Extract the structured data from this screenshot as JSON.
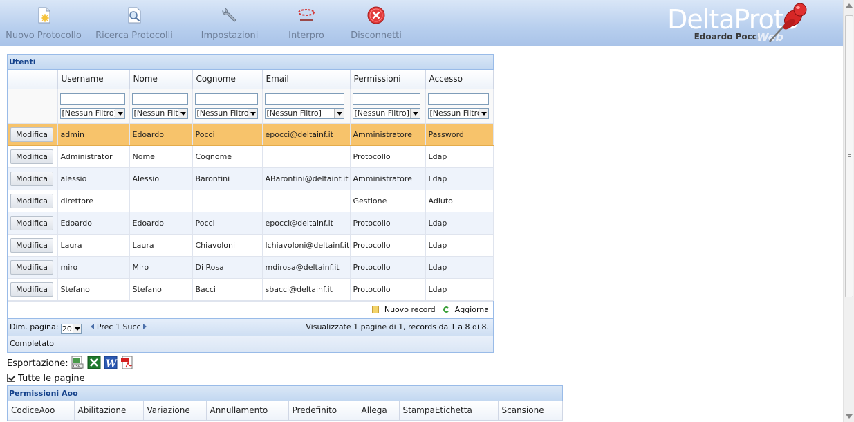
{
  "toolbar": {
    "items": [
      {
        "label": "Nuovo Protocollo",
        "icon": "new-document-icon"
      },
      {
        "label": "Ricerca Protocolli",
        "icon": "search-document-icon"
      },
      {
        "label": "Impostazioni",
        "icon": "wrench-icon"
      },
      {
        "label": "Interpro",
        "icon": "interpro-logo-icon"
      },
      {
        "label": "Disconnetti",
        "icon": "disconnect-icon"
      }
    ]
  },
  "brand": {
    "name": "DeltaProto",
    "suffix": "Web",
    "user": "Edoardo Pocci"
  },
  "users_panel": {
    "title": "Utenti",
    "columns": [
      "Username",
      "Nome",
      "Cognome",
      "Email",
      "Permissioni",
      "Accesso"
    ],
    "filter_option": [
      "[Nessun Filtro]",
      "[Nessun Filtro]",
      "[Nessun Filtro]",
      "[Nessun Filtro]",
      "[Nessun Filtro]",
      "[Nessun Filtro]"
    ],
    "edit_label": "Modifica",
    "rows": [
      {
        "username": "admin",
        "nome": "Edoardo",
        "cognome": "Pocci",
        "email": "epocci@deltainf.it",
        "permissioni": "Amministratore",
        "accesso": "Password"
      },
      {
        "username": "Administrator",
        "nome": "Nome",
        "cognome": "Cognome",
        "email": "",
        "permissioni": "Protocollo",
        "accesso": "Ldap"
      },
      {
        "username": "alessio",
        "nome": "Alessio",
        "cognome": "Barontini",
        "email": "ABarontini@deltainf.it",
        "permissioni": "Amministratore",
        "accesso": "Ldap"
      },
      {
        "username": "direttore",
        "nome": "",
        "cognome": "",
        "email": "",
        "permissioni": "Gestione",
        "accesso": "Adiuto"
      },
      {
        "username": "Edoardo",
        "nome": "Edoardo",
        "cognome": "Pocci",
        "email": "epocci@deltainf.it",
        "permissioni": "Protocollo",
        "accesso": "Ldap"
      },
      {
        "username": "Laura",
        "nome": "Laura",
        "cognome": "Chiavoloni",
        "email": "lchiavoloni@deltainf.it",
        "permissioni": "Protocollo",
        "accesso": "Ldap"
      },
      {
        "username": "miro",
        "nome": "Miro",
        "cognome": "Di Rosa",
        "email": "mdirosa@deltainf.it",
        "permissioni": "Protocollo",
        "accesso": "Ldap"
      },
      {
        "username": "Stefano",
        "nome": "Stefano",
        "cognome": "Bacci",
        "email": "sbacci@deltainf.it",
        "permissioni": "Protocollo",
        "accesso": "Ldap"
      }
    ],
    "new_record": "Nuovo record",
    "refresh": "Aggiorna",
    "pager": {
      "page_size_label": "Dim. pagina:",
      "page_size": "20",
      "prev": "Prec",
      "page": "1",
      "next": "Succ",
      "info": "Visualizzate 1 pagine di 1, records da 1 a 8 di 8."
    },
    "status": "Completato"
  },
  "export": {
    "label": "Esportazione:",
    "formats": [
      "csv-icon",
      "excel-icon",
      "word-icon",
      "pdf-icon"
    ]
  },
  "all_pages": {
    "label": "Tutte le pagine",
    "checked": true
  },
  "aoo_panel": {
    "title": "Permissioni Aoo",
    "columns": [
      "CodiceAoo",
      "Abilitazione",
      "Variazione",
      "Annullamento",
      "Predefinito",
      "Allega",
      "StampaEtichetta",
      "Scansione"
    ]
  }
}
